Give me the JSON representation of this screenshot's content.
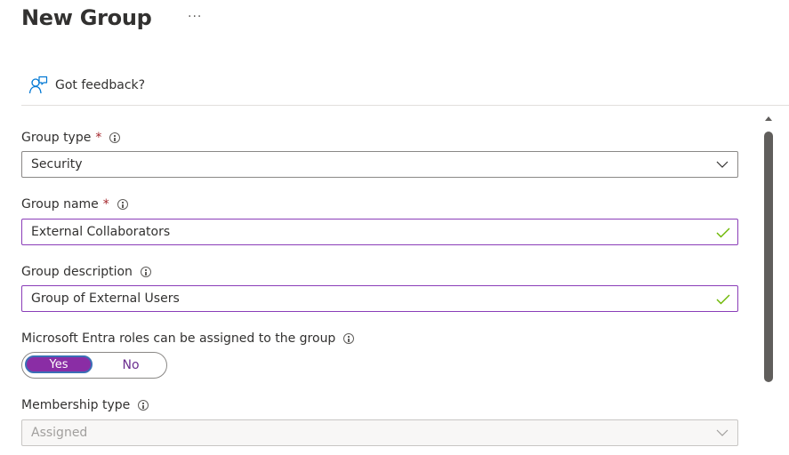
{
  "header": {
    "title": "New Group",
    "more_label": "···"
  },
  "toolbar": {
    "feedback_label": "Got feedback?",
    "feedback_icon": "feedback-icon"
  },
  "form": {
    "group_type": {
      "label": "Group type",
      "required_mark": "*",
      "value": "Security"
    },
    "group_name": {
      "label": "Group name",
      "required_mark": "*",
      "value": "External Collaborators"
    },
    "group_description": {
      "label": "Group description",
      "value": "Group of External Users"
    },
    "entra_roles": {
      "label": "Microsoft Entra roles can be assigned to the group",
      "yes_label": "Yes",
      "no_label": "No",
      "selected": "Yes"
    },
    "membership_type": {
      "label": "Membership type",
      "value": "Assigned",
      "disabled": true
    }
  },
  "colors": {
    "accent": "#8a2da5",
    "valid": "#8a3db8",
    "check": "#6bb700",
    "required": "#a4262c",
    "link_icon": "#0078d4"
  }
}
